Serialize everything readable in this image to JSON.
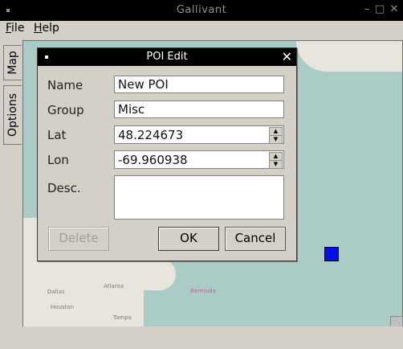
{
  "window": {
    "title": "Gallivant",
    "controls": {
      "minimize": "–",
      "maximize": "□",
      "close": "✕"
    }
  },
  "menu": {
    "file_first": "F",
    "file_rest": "ile",
    "help_first": "H",
    "help_rest": "elp"
  },
  "tabs": [
    {
      "label": "Map"
    },
    {
      "label": "Options"
    }
  ],
  "map": {
    "labels": {
      "dallas": "Dallas",
      "atlanta": "Atlanta",
      "houston": "Houston",
      "bermuda": "Bermuda",
      "tampa": "Tampa"
    },
    "marker_color": "#0010e0"
  },
  "dialog": {
    "title": "POI Edit",
    "close": "✕",
    "fields": {
      "name": {
        "label": "Name",
        "value": "New POI"
      },
      "group": {
        "label": "Group",
        "value": "Misc"
      },
      "lat": {
        "label": "Lat",
        "value": "48.224673"
      },
      "lon": {
        "label": "Lon",
        "value": "-69.960938"
      },
      "desc": {
        "label": "Desc.",
        "value": ""
      }
    },
    "buttons": {
      "delete": "Delete",
      "ok": "OK",
      "cancel": "Cancel"
    }
  }
}
